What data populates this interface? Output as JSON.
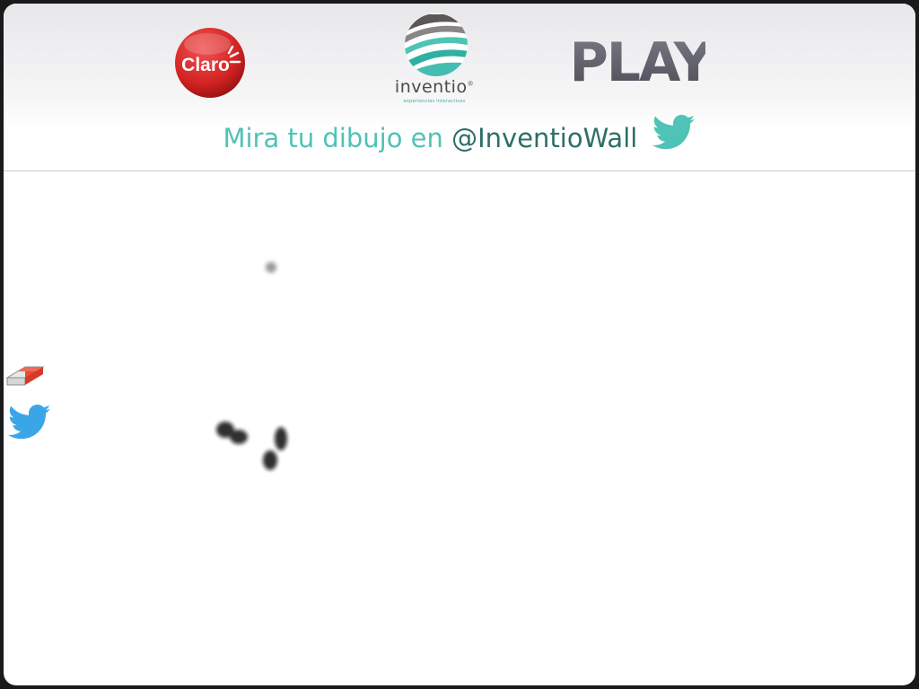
{
  "header": {
    "claro_logo": {
      "text": "Claro",
      "color": "#d42b2b"
    },
    "inventio_logo": {
      "name": "inventio",
      "registered": "®",
      "tagline": "experiencias interactivas",
      "accent": "#4fc3b5"
    },
    "play_logo": {
      "text": "PLAY",
      "color": "#5f5f6b"
    }
  },
  "tagline": {
    "prefix": "Mira tu dibujo en ",
    "handle": "@InventioWall",
    "icon": "twitter-bird-icon",
    "prefix_color": "#4fc3b5",
    "handle_color": "#2d6f68"
  },
  "toolbar": {
    "eraser_icon": "eraser-icon",
    "share_icon": "twitter-bird-icon",
    "share_color": "#3aa6e8"
  },
  "canvas": {
    "background": "#ffffff",
    "ink_color": "#111111"
  }
}
